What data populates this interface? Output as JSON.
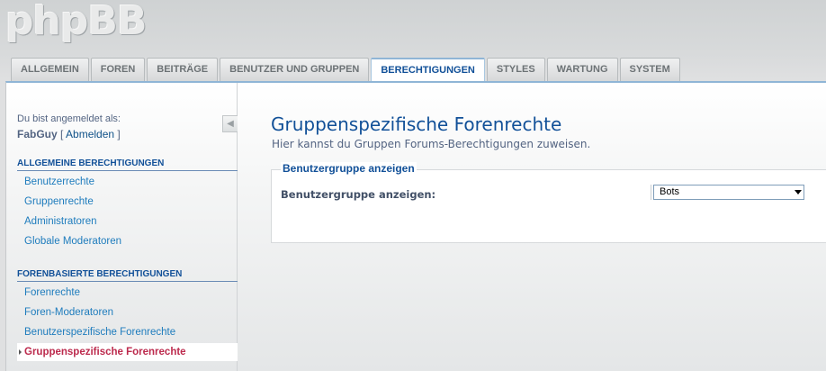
{
  "logo": {
    "text": "phpBB"
  },
  "tabs": [
    {
      "label": "ALLGEMEIN",
      "active": false
    },
    {
      "label": "FOREN",
      "active": false
    },
    {
      "label": "BEITRÄGE",
      "active": false
    },
    {
      "label": "BENUTZER UND GRUPPEN",
      "active": false
    },
    {
      "label": "BERECHTIGUNGEN",
      "active": true
    },
    {
      "label": "STYLES",
      "active": false
    },
    {
      "label": "WARTUNG",
      "active": false
    },
    {
      "label": "SYSTEM",
      "active": false
    }
  ],
  "sidebar": {
    "login_label": "Du bist angemeldet als:",
    "username": "FabGuy",
    "logout_prefix": "[ ",
    "logout_label": "Abmelden",
    "logout_suffix": " ]",
    "sections": [
      {
        "heading": "ALLGEMEINE BERECHTIGUNGEN",
        "items": [
          "Benutzerrechte",
          "Gruppenrechte",
          "Administratoren",
          "Globale Moderatoren"
        ]
      },
      {
        "heading": "FORENBASIERTE BERECHTIGUNGEN",
        "items": [
          "Forenrechte",
          "Foren-Moderatoren",
          "Benutzerspezifische Forenrechte",
          "Gruppenspezifische Forenrechte"
        ]
      }
    ],
    "active_item": "Gruppenspezifische Forenrechte"
  },
  "main": {
    "title": "Gruppenspezifische Forenrechte",
    "description": "Hier kannst du Gruppen Forums-Berechtigungen zuweisen.",
    "fieldset": {
      "legend": "Benutzergruppe anzeigen",
      "label": "Benutzergruppe anzeigen:",
      "select_value": "Bots"
    }
  },
  "colors": {
    "accent": "#115098",
    "link": "#1e7cbd",
    "active_link": "#bc2a4d"
  }
}
